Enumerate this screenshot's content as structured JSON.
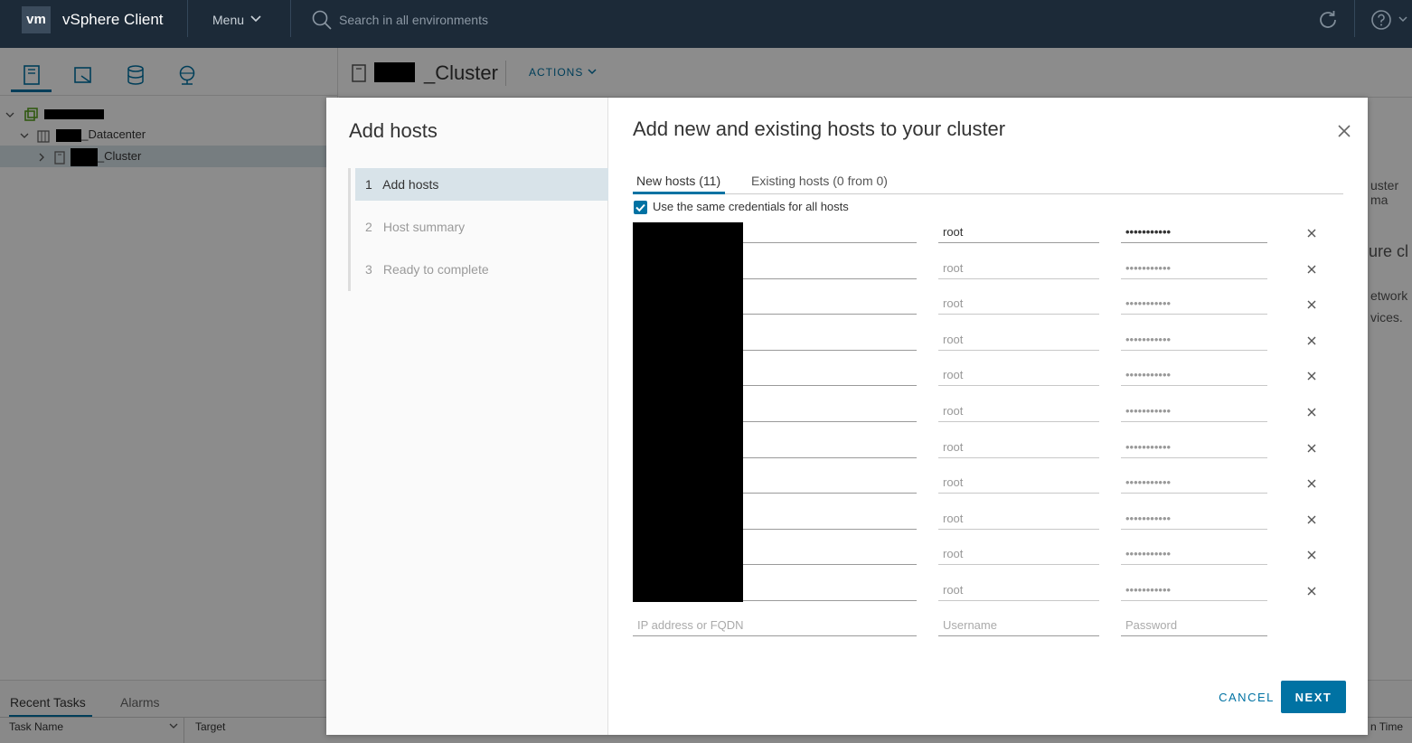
{
  "header": {
    "logo": "vm",
    "app_title": "vSphere Client",
    "menu_label": "Menu",
    "search_placeholder": "Search in all environments"
  },
  "tree": {
    "datacenter_label": "_Datacenter",
    "cluster_label": "_Cluster"
  },
  "object_header": {
    "title": "_Cluster",
    "actions_label": "ACTIONS"
  },
  "background_fragments": {
    "frag1": "uster ma",
    "frag2": "ure cl",
    "frag3": "etwork",
    "frag4": "vices.",
    "frag5": "n Time"
  },
  "bottom": {
    "tabs": [
      "Recent Tasks",
      "Alarms"
    ],
    "columns": [
      "Task Name",
      "Target"
    ]
  },
  "wizard": {
    "title": "Add hosts",
    "steps": [
      {
        "num": "1",
        "label": "Add hosts"
      },
      {
        "num": "2",
        "label": "Host summary"
      },
      {
        "num": "3",
        "label": "Ready to complete"
      }
    ]
  },
  "content": {
    "title": "Add new and existing hosts to your cluster",
    "tabs": [
      "New hosts (11)",
      "Existing hosts (0 from 0)"
    ],
    "same_credentials_label": "Use the same credentials for all hosts",
    "same_credentials_checked": true,
    "hosts": [
      {
        "username": "root",
        "password": "•••••••••••"
      },
      {
        "username": "root",
        "password": "•••••••••••"
      },
      {
        "username": "root",
        "password": "•••••••••••"
      },
      {
        "username": "root",
        "password": "•••••••••••"
      },
      {
        "username": "root",
        "password": "•••••••••••"
      },
      {
        "username": "root",
        "password": "•••••••••••"
      },
      {
        "username": "root",
        "password": "•••••••••••"
      },
      {
        "username": "root",
        "password": "•••••••••••"
      },
      {
        "username": "root",
        "password": "•••••••••••"
      },
      {
        "username": "root",
        "password": "•••••••••••"
      },
      {
        "username": "root",
        "password": "•••••••••••"
      }
    ],
    "new_row": {
      "host_placeholder": "IP address or FQDN",
      "username_placeholder": "Username",
      "password_placeholder": "Password"
    },
    "cancel_label": "CANCEL",
    "next_label": "NEXT"
  },
  "colors": {
    "header_bg": "#1c2a38",
    "accent": "#0072a3",
    "selected_bg": "#d8e3e9"
  }
}
